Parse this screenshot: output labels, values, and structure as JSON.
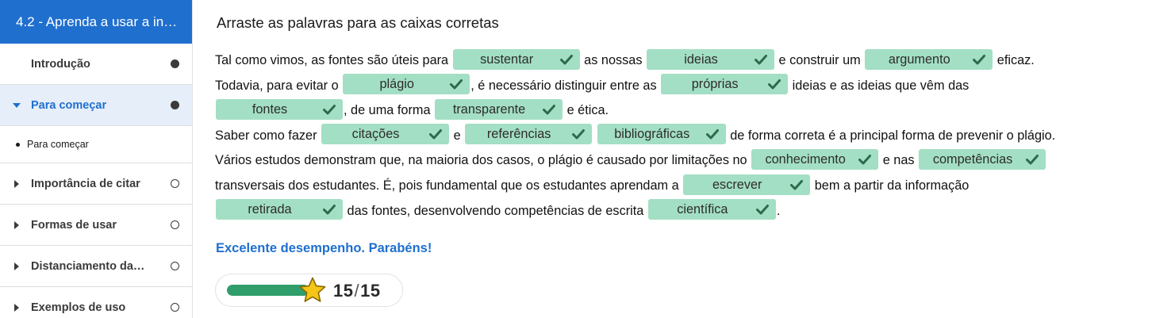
{
  "sidebar": {
    "header": "4.2 - Aprenda a usar a in…",
    "items": [
      {
        "label": "Introdução",
        "status": "filled"
      },
      {
        "label": "Para começar",
        "status": "filled",
        "active": true
      },
      {
        "label": "Importância de citar",
        "status": "empty"
      },
      {
        "label": "Formas de usar",
        "status": "empty"
      },
      {
        "label": "Distanciamento da…",
        "status": "empty"
      },
      {
        "label": "Exemplos de uso",
        "status": "empty"
      }
    ],
    "subitem": "Para começar"
  },
  "main": {
    "title": "Arraste as palavras para as caixas corretas",
    "segments": {
      "s1": "Tal como vimos, as fontes são úteis para",
      "s2": "as nossas",
      "s3": "e construir um",
      "s4": "eficaz.",
      "s5": "Todavia, para evitar o",
      "s6": ", é necessário distinguir entre as",
      "s7": "ideias e as ideias que vêm das",
      "s8": ", de uma forma",
      "s9": "e ética.",
      "s10": "Saber como fazer",
      "s11": "e",
      "s12": "de forma correta é a principal forma de prevenir o plágio.",
      "s13": "Vários estudos demonstram que, na maioria dos casos, o plágio é causado por limitações no",
      "s14": "e nas",
      "s15": "transversais dos estudantes. É, pois fundamental que os estudantes aprendam a",
      "s16": "bem a partir da informação",
      "s17": "das fontes, desenvolvendo competências de escrita",
      "s18": "."
    },
    "drops": {
      "d1": "sustentar",
      "d2": "ideias",
      "d3": "argumento",
      "d4": "plágio",
      "d5": "próprias",
      "d6": "fontes",
      "d7": "transparente",
      "d8": "citações",
      "d9": "referências",
      "d10": "bibliográficas",
      "d11": "conhecimento",
      "d12": "competências",
      "d13": "escrever",
      "d14": "retirada",
      "d15": "científica"
    },
    "feedback": "Excelente desempenho. Parabéns!",
    "score": {
      "value": "15",
      "separator": "/",
      "max": "15",
      "progress": 1.0
    }
  },
  "colors": {
    "accent": "#1f6fcf",
    "drop_correct_bg": "#a3dfc4",
    "check": "#2b6b4b",
    "progress": "#2f9e6a",
    "star": "#f5c518"
  },
  "icons": {
    "caret_right": "caret-right-icon",
    "caret_down": "caret-down-icon",
    "check": "check-icon",
    "star": "star-icon"
  }
}
